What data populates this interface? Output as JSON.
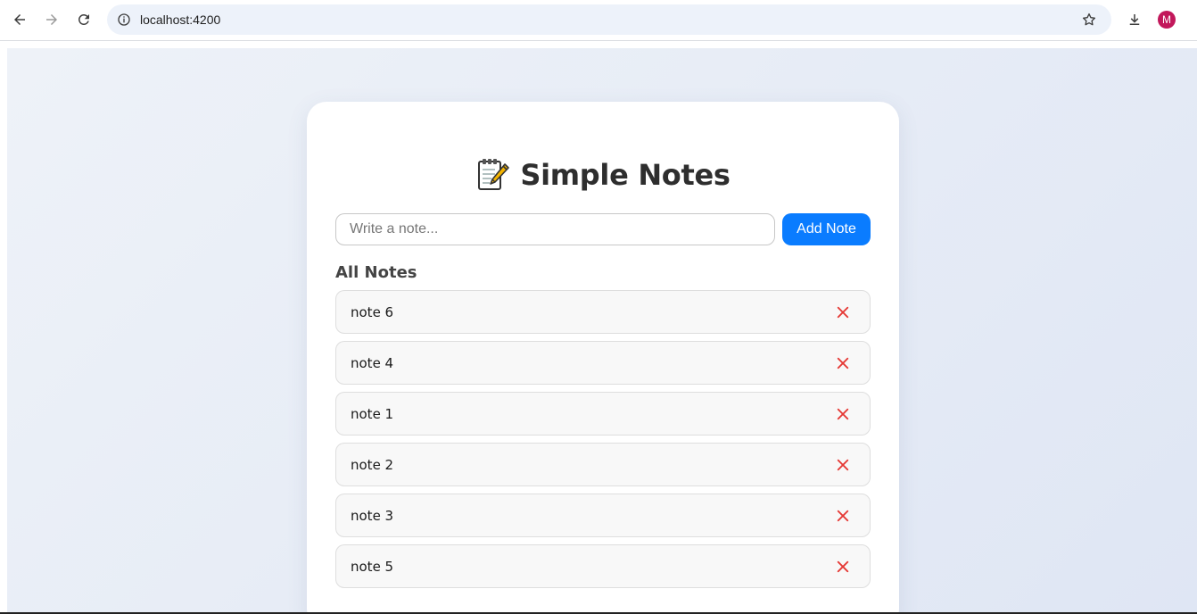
{
  "browser": {
    "url": "localhost:4200",
    "profile_initial": "M",
    "profile_color": "#c2185b"
  },
  "app": {
    "title": "Simple Notes",
    "title_icon": "memo-icon",
    "input_placeholder": "Write a note...",
    "input_value": "",
    "add_button_label": "Add Note",
    "section_heading": "All Notes",
    "accent_color": "#0a7cff",
    "delete_color": "#e53935",
    "notes": [
      {
        "text": "note 6"
      },
      {
        "text": "note 4"
      },
      {
        "text": "note 1"
      },
      {
        "text": "note 2"
      },
      {
        "text": "note 3"
      },
      {
        "text": "note 5"
      }
    ]
  }
}
